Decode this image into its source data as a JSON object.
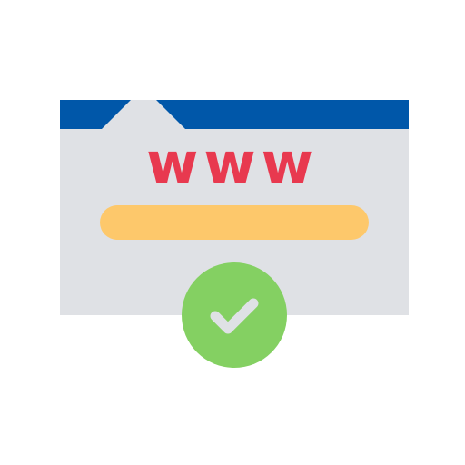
{
  "illustration": {
    "url_text": "www",
    "icon": "verified-website-check-icon"
  },
  "colors": {
    "frame": "#dfe1e5",
    "title_bar": "#0057a9",
    "url_text": "#e8394f",
    "address_bar": "#fdc86b",
    "badge": "#84d062",
    "check": "#dfe1e5"
  }
}
